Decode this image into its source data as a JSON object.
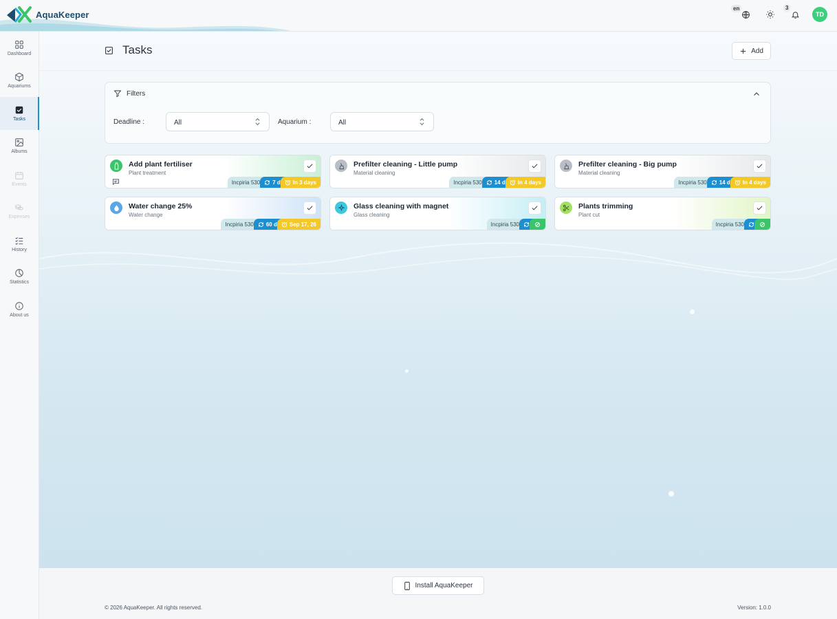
{
  "app": {
    "name": "AquaKeeper"
  },
  "header": {
    "lang": "en",
    "notif_count": "3",
    "user_initials": "TD"
  },
  "sidebar": {
    "items": [
      {
        "label": "Dashboard",
        "icon": "grid-icon"
      },
      {
        "label": "Aquariums",
        "icon": "cube-icon"
      },
      {
        "label": "Tasks",
        "icon": "checkbox-icon"
      },
      {
        "label": "Albums",
        "icon": "image-icon"
      },
      {
        "label": "Events",
        "icon": "calendar-icon"
      },
      {
        "label": "Expenses",
        "icon": "coins-icon"
      },
      {
        "label": "History",
        "icon": "list-check-icon"
      },
      {
        "label": "Statistics",
        "icon": "pie-chart-icon"
      },
      {
        "label": "About us",
        "icon": "info-icon"
      }
    ]
  },
  "page": {
    "title": "Tasks",
    "add_label": "Add"
  },
  "filters": {
    "title": "Filters",
    "deadline_label": "Deadline :",
    "deadline_value": "All",
    "aquarium_label": "Aquarium :",
    "aquarium_value": "All"
  },
  "tasks": [
    {
      "title": "Add plant fertiliser",
      "category": "Plant treatment",
      "aquarium": "Incpiria 530",
      "frequency": "7 d",
      "due": "In 3 days",
      "color": "#3cc46a",
      "has_comment": true
    },
    {
      "title": "Prefilter cleaning - Little pump",
      "category": "Material cleaning",
      "aquarium": "Incpiria 530",
      "frequency": "14 d",
      "due": "In 4 days",
      "color": "#b9bec4"
    },
    {
      "title": "Prefilter cleaning - Big pump",
      "category": "Material cleaning",
      "aquarium": "Incpiria 530",
      "frequency": "14 d",
      "due": "In 4 days",
      "color": "#b9bec4"
    },
    {
      "title": "Water change 25%",
      "category": "Water change",
      "aquarium": "Incpiria 530",
      "frequency": "60 d",
      "due": "Sep 17, 26",
      "color": "#5aa7e8"
    },
    {
      "title": "Glass cleaning with magnet",
      "category": "Glass cleaning",
      "aquarium": "Incpiria 530",
      "frequency": "",
      "due": "",
      "color": "#3cc9e0"
    },
    {
      "title": "Plants trimming",
      "category": "Plant cut",
      "aquarium": "Incpiria 530",
      "frequency": "",
      "due": "",
      "color": "#a3e063"
    }
  ],
  "footer": {
    "install_label": "Install AquaKeeper",
    "copyright": "© 2026 AquaKeeper. All rights reserved.",
    "version": "Version:  1.0.0"
  }
}
